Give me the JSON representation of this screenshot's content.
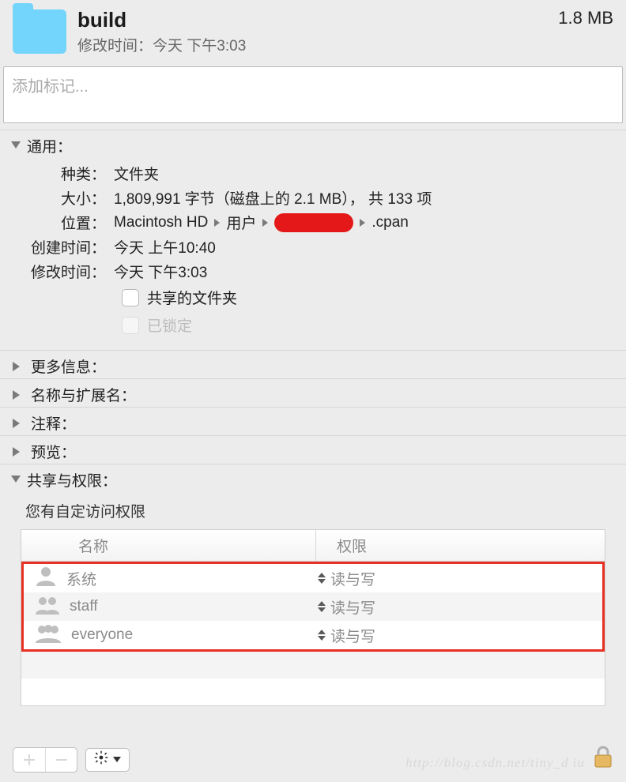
{
  "header": {
    "title": "build",
    "modified_label": "修改时间：",
    "modified_value": "今天 下午3:03",
    "size": "1.8 MB"
  },
  "tags": {
    "placeholder": "添加标记..."
  },
  "sections": {
    "general": "通用：",
    "more_info": "更多信息：",
    "name_ext": "名称与扩展名：",
    "comments": "注释：",
    "preview": "预览：",
    "sharing": "共享与权限："
  },
  "general": {
    "kind_label": "种类：",
    "kind_value": "文件夹",
    "size_label": "大小：",
    "size_value": "1,809,991 字节（磁盘上的 2.1 MB）， 共 133 项",
    "where_label": "位置：",
    "where_path": {
      "seg1": "Macintosh HD",
      "seg2": "用户",
      "seg4": ".cpan"
    },
    "created_label": "创建时间：",
    "created_value": "今天 上午10:40",
    "modified_label": "修改时间：",
    "modified_value": "今天 下午3:03",
    "shared_folder": "共享的文件夹",
    "locked": "已锁定"
  },
  "perm": {
    "custom_msg": "您有自定访问权限",
    "col_name": "名称",
    "col_priv": "权限",
    "rows": [
      {
        "name": "系统",
        "priv": "读与写"
      },
      {
        "name": "staff",
        "priv": "读与写"
      },
      {
        "name": "everyone",
        "priv": "读与写"
      }
    ]
  },
  "watermark": "http://blog.csdn.net/tiny_d   iu"
}
